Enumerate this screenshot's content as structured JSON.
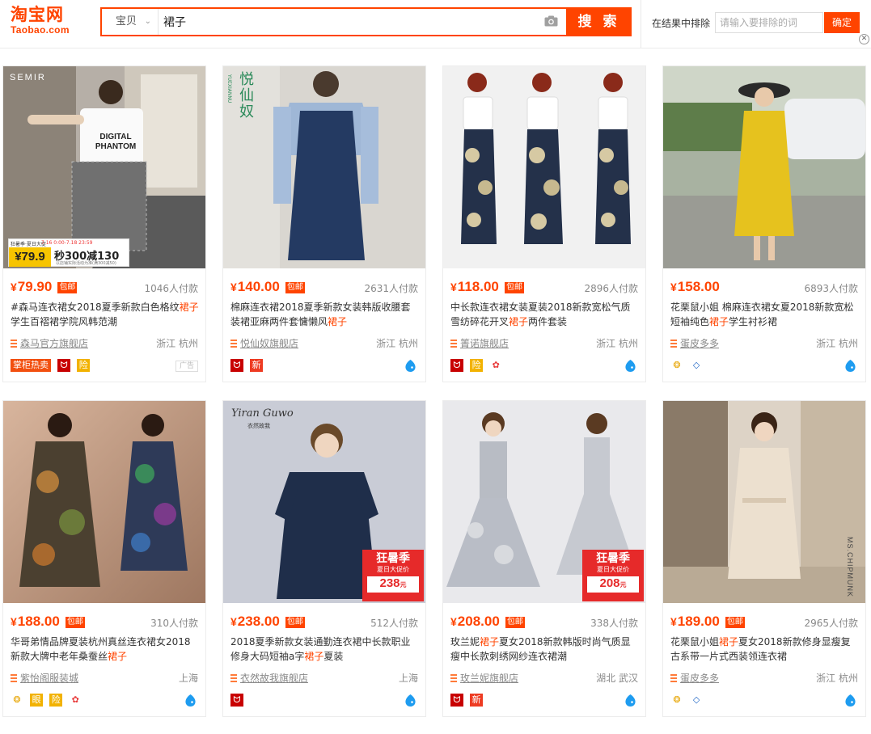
{
  "header": {
    "logo_cn": "淘宝网",
    "logo_en": "Taobao.com",
    "search_category": "宝贝",
    "search_query": "裙子",
    "search_button": "搜 索",
    "exclude_label": "在结果中排除",
    "exclude_placeholder": "请输入要排除的词",
    "confirm_button": "确定"
  },
  "colors": {
    "accent": "#ff4400"
  },
  "products": [
    {
      "price": "79.90",
      "free_ship": "包邮",
      "buyers": "1046人付款",
      "title_pre": "#森马连衣裙女2018夏季新款白色格纹",
      "title_hl": "裙子",
      "title_post": "学生百褶裙学院风韩范潮",
      "shop": "森马官方旗舰店",
      "location": "浙江 杭州",
      "badge_text": "掌柜热卖",
      "ad_label": "广告",
      "img_brand": "SEMIR",
      "img_shirt_line1": "DIGITAL",
      "img_shirt_line2": "PHANTOM",
      "img_promo_price": "¥79.9",
      "img_promo_text": "秒300减130",
      "img_promo_tag": "狂暑季·夏日大促",
      "img_promo_date": "7.16 0:00-7.18 23:59",
      "img_promo_note": "以店铺实际活动为准(满300减50)"
    },
    {
      "price": "140.00",
      "free_ship": "包邮",
      "buyers": "2631人付款",
      "title_pre": "棉麻连衣裙2018夏季新款女装韩版收腰套装裙亚麻两件套慵懒风",
      "title_hl": "裙子",
      "title_post": "",
      "shop": "悦仙奴旗舰店",
      "location": "浙江 杭州",
      "img_brand": "悦仙奴",
      "img_brand_sub": "YUEXIANNU"
    },
    {
      "price": "118.00",
      "free_ship": "包邮",
      "buyers": "2896人付款",
      "title_pre": "中长款连衣裙女装夏装2018新款宽松气质雪纺碎花开叉",
      "title_hl": "裙子",
      "title_post": "两件套装",
      "shop": "箐诺旗舰店",
      "location": "浙江 杭州"
    },
    {
      "price": "158.00",
      "free_ship": "",
      "buyers": "6893人付款",
      "title_pre": "花栗鼠小姐 棉麻连衣裙女夏2018新款宽松短袖纯色",
      "title_hl": "裙子",
      "title_post": "学生衬衫裙",
      "shop": "蛋皮多多",
      "location": "浙江 杭州"
    },
    {
      "price": "188.00",
      "free_ship": "包邮",
      "buyers": "310人付款",
      "title_pre": "华哥弟情品牌夏装杭州真丝连衣裙女2018新款大牌中老年桑蚕丝",
      "title_hl": "裙子",
      "title_post": "",
      "shop": "紫怡阁服装城",
      "location": "上海",
      "badge_eye": "眼",
      "badge_bao": "险"
    },
    {
      "price": "238.00",
      "free_ship": "包邮",
      "buyers": "512人付款",
      "title_pre": "2018夏季新款女装通勤连衣裙中长款职业修身大码短袖a字",
      "title_hl": "裙子",
      "title_post": "夏装",
      "shop": "衣然故我旗舰店",
      "location": "上海",
      "img_brand": "Yiran Guwo",
      "img_brand_sub": "衣然故我",
      "img_tag_title": "狂暑季",
      "img_tag_sub": "夏日大促价",
      "img_tag_price": "238",
      "img_tag_unit": "元"
    },
    {
      "price": "208.00",
      "free_ship": "包邮",
      "buyers": "338人付款",
      "title_pre": "玫兰妮",
      "title_hl": "裙子",
      "title_post": "夏女2018新款韩版时尚气质显瘦中长款刺绣网纱连衣裙潮",
      "shop": "玫兰妮旗舰店",
      "location": "湖北 武汉",
      "img_tag_title": "狂暑季",
      "img_tag_sub": "夏日大促价",
      "img_tag_price": "208",
      "img_tag_unit": "元"
    },
    {
      "price": "189.00",
      "free_ship": "包邮",
      "buyers": "2965人付款",
      "title_pre": "花栗鼠小姐",
      "title_hl": "裙子",
      "title_post": "夏女2018新款修身显瘦复古系带一片式西装领连衣裙",
      "shop": "蛋皮多多",
      "location": "浙江 杭州",
      "img_brand": "MS.CHIPMUNK"
    }
  ],
  "badges": {
    "new": "新",
    "bao": "险",
    "tmall_icon": "tmall-cat-icon",
    "ww_icon": "wangwang-icon"
  }
}
